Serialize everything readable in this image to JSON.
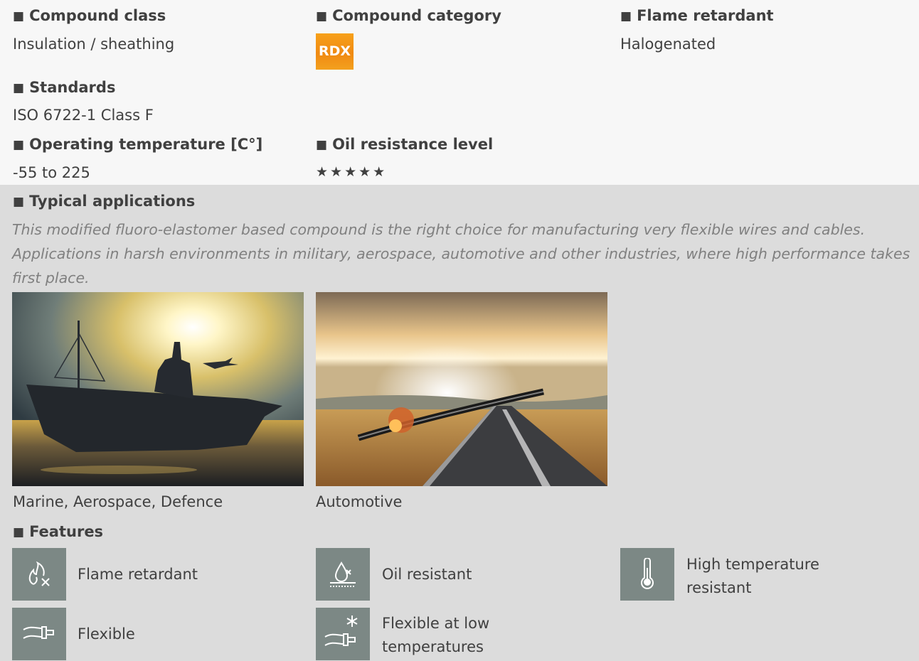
{
  "compound_class": {
    "label": "Compound class",
    "value": "Insulation / sheathing"
  },
  "compound_category": {
    "label": "Compound category",
    "badge": "RDX",
    "badge_color": "#f08a12"
  },
  "flame_retardant": {
    "label": "Flame retardant",
    "value": "Halogenated"
  },
  "standards": {
    "label": "Standards",
    "value": "ISO 6722-1 Class F"
  },
  "operating_temperature": {
    "label": "Operating temperature [C°]",
    "value": "-55 to 225"
  },
  "oil_resistance": {
    "label": "Oil resistance level",
    "stars": "★★★★★",
    "rating": 5,
    "max": 5
  },
  "typical_applications": {
    "label": "Typical applications",
    "text": "This modified fluoro-elastomer based compound is the right choice for manufacturing very flexible wires and cables. Applications in harsh environments in military, aerospace, automotive and other industries, where high performance takes first place.",
    "images": [
      {
        "caption": "Marine, Aerospace, Defence"
      },
      {
        "caption": "Automotive"
      }
    ]
  },
  "features": {
    "label": "Features",
    "items": [
      {
        "label": "Flame retardant",
        "icon": "flame-retardant-icon"
      },
      {
        "label": "Oil resistant",
        "icon": "oil-resistant-icon"
      },
      {
        "label": "High temperature resistant",
        "icon": "thermometer-icon"
      },
      {
        "label": "Flexible",
        "icon": "flexible-cable-icon"
      },
      {
        "label": "Flexible at low temperatures",
        "icon": "snowflake-cable-icon"
      }
    ]
  },
  "colors": {
    "icon_bg": "#7c8885",
    "grey_section": "#dcdcdc",
    "badge": "#f08a12"
  }
}
